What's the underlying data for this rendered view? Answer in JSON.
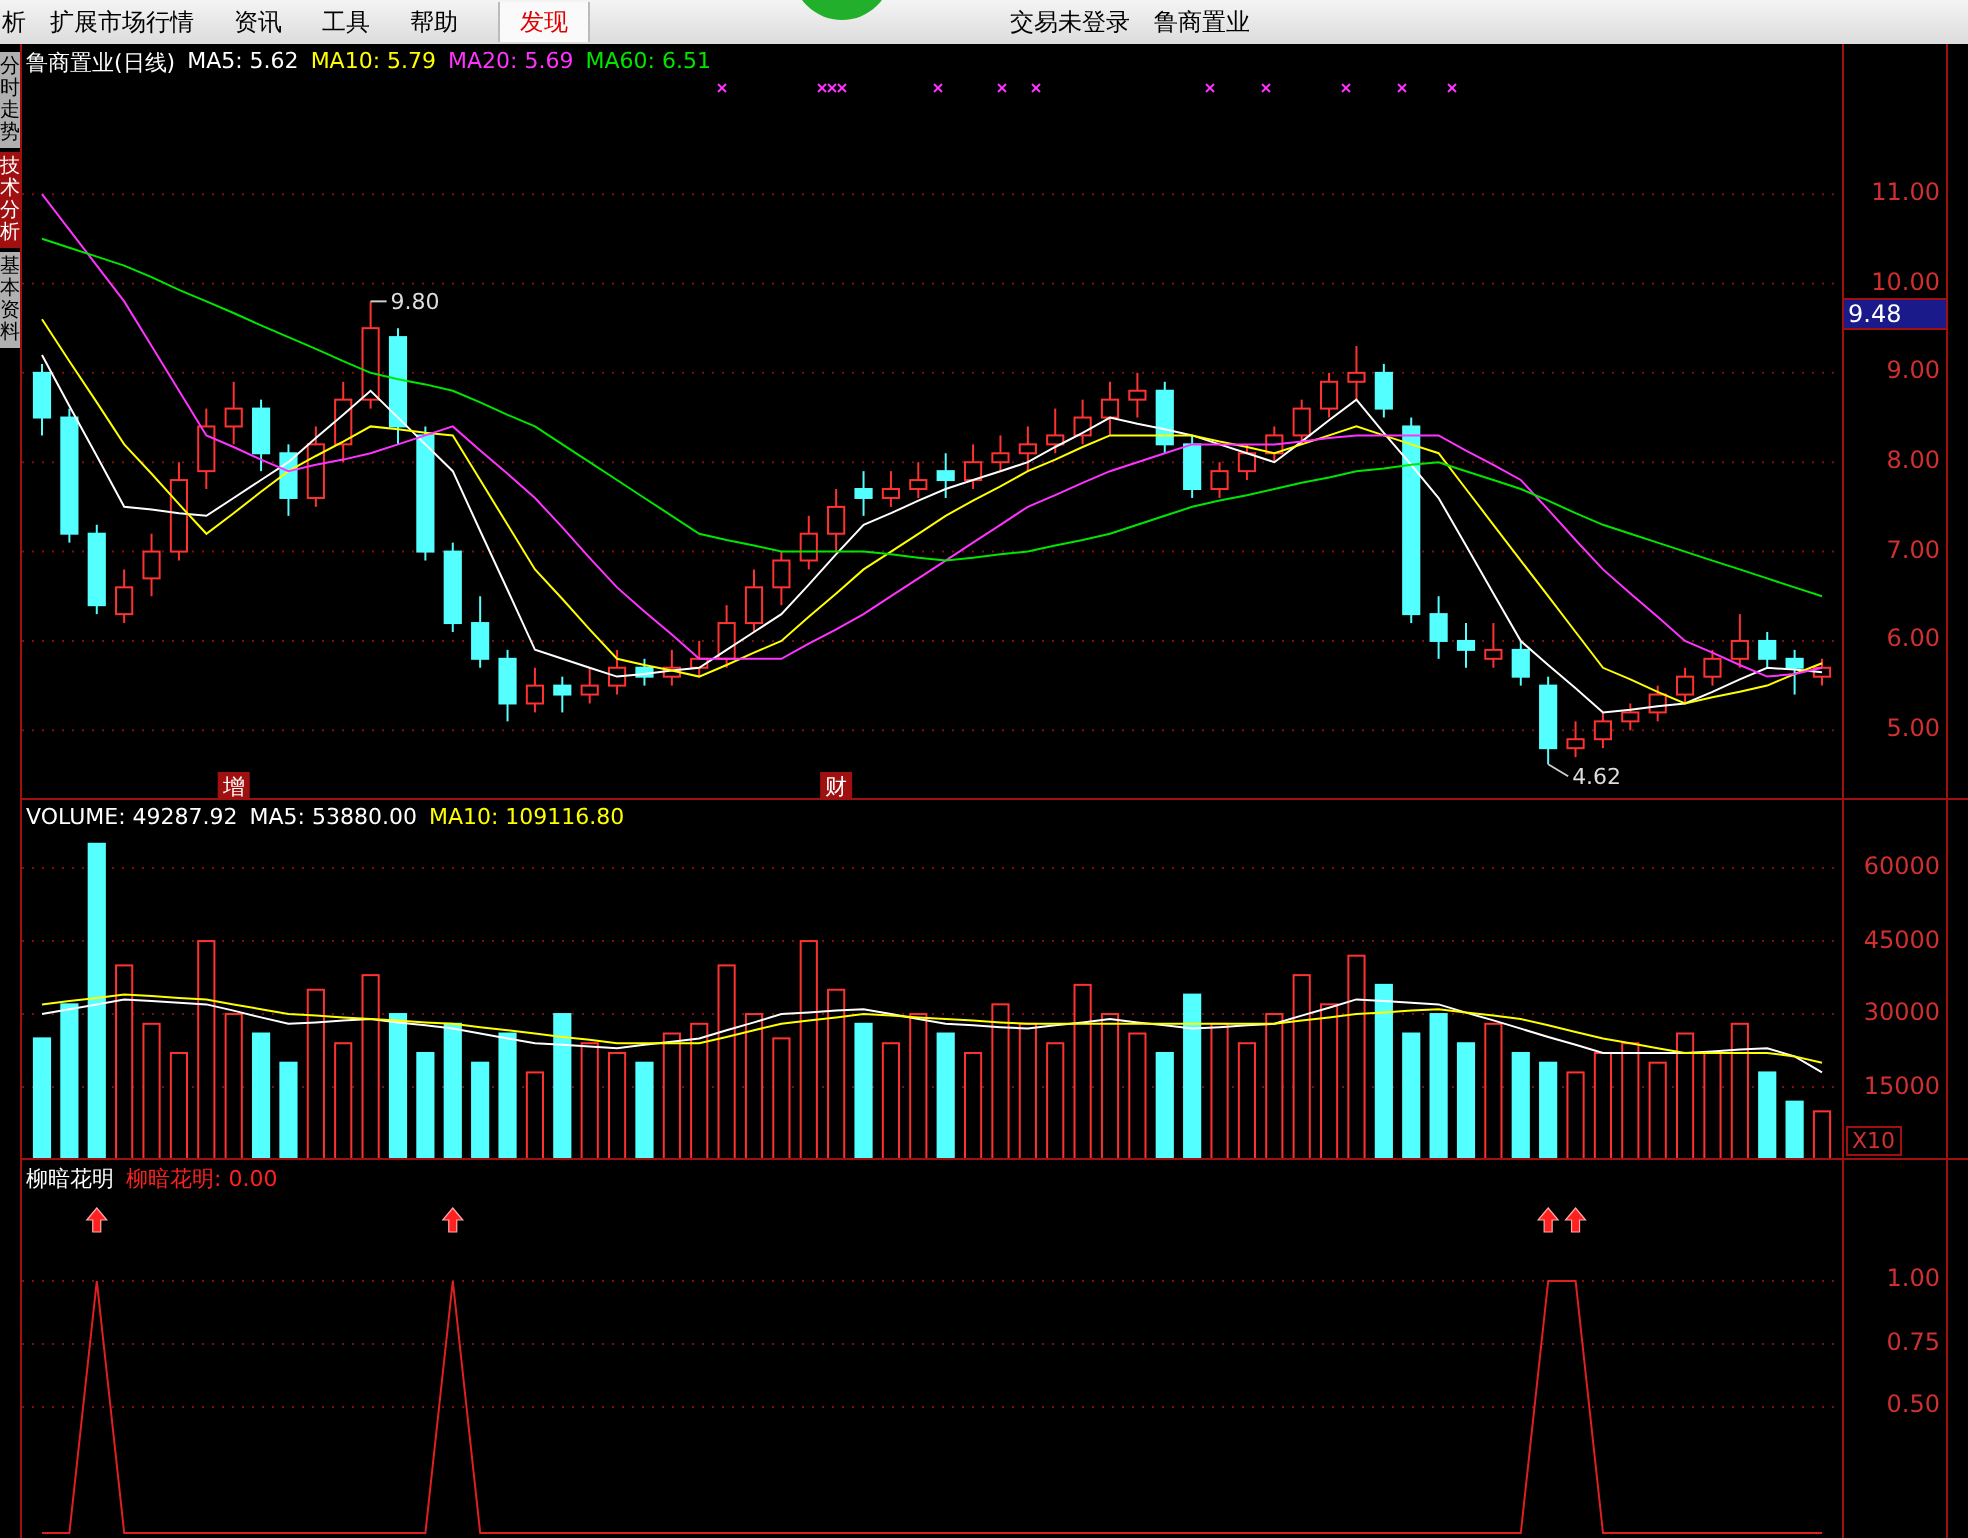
{
  "menu_bar": {
    "items": [
      {
        "label": "析",
        "selected": false
      },
      {
        "label": "扩展市场行情",
        "selected": false
      },
      {
        "label": "资讯",
        "selected": false
      },
      {
        "label": "工具",
        "selected": false
      },
      {
        "label": "帮助",
        "selected": false
      },
      {
        "label": "发现",
        "selected": true
      }
    ],
    "status": [
      "交易未登录",
      "鲁商置业"
    ]
  },
  "side_tabs": [
    {
      "label": "分时走势",
      "selected": false
    },
    {
      "label": "技术分析",
      "selected": true
    },
    {
      "label": "基本资料",
      "selected": false
    }
  ],
  "price_panel": {
    "legend": [
      {
        "text": "鲁商置业(日线)",
        "color": "#ffffff"
      },
      {
        "text": "MA5: 5.62",
        "color": "#ffffff"
      },
      {
        "text": "MA10: 5.79",
        "color": "#ffff00"
      },
      {
        "text": "MA20: 5.69",
        "color": "#ff33ff"
      },
      {
        "text": "MA60: 6.51",
        "color": "#00e600"
      }
    ],
    "current_price": "9.48",
    "high_label": "9.80",
    "low_label": "4.62",
    "event_markers": [
      "增",
      "财"
    ],
    "chart_data": {
      "type": "candlestick",
      "ylim": [
        4.22,
        12.68
      ],
      "ohlc": [
        [
          9.0,
          9.1,
          8.3,
          8.5
        ],
        [
          8.5,
          8.6,
          7.1,
          7.2
        ],
        [
          7.2,
          7.3,
          6.3,
          6.4
        ],
        [
          6.3,
          6.8,
          6.2,
          6.6
        ],
        [
          6.7,
          7.2,
          6.5,
          7.0
        ],
        [
          7.0,
          8.0,
          6.9,
          7.8
        ],
        [
          7.9,
          8.6,
          7.7,
          8.4
        ],
        [
          8.4,
          8.9,
          8.2,
          8.6
        ],
        [
          8.6,
          8.7,
          7.9,
          8.1
        ],
        [
          8.1,
          8.2,
          7.4,
          7.6
        ],
        [
          7.6,
          8.4,
          7.5,
          8.2
        ],
        [
          8.2,
          8.9,
          8.0,
          8.7
        ],
        [
          8.7,
          9.8,
          8.6,
          9.5
        ],
        [
          9.4,
          9.5,
          8.2,
          8.4
        ],
        [
          8.3,
          8.4,
          6.9,
          7.0
        ],
        [
          7.0,
          7.1,
          6.1,
          6.2
        ],
        [
          6.2,
          6.5,
          5.7,
          5.8
        ],
        [
          5.8,
          5.9,
          5.1,
          5.3
        ],
        [
          5.3,
          5.7,
          5.2,
          5.5
        ],
        [
          5.5,
          5.6,
          5.2,
          5.4
        ],
        [
          5.4,
          5.7,
          5.3,
          5.5
        ],
        [
          5.5,
          5.9,
          5.4,
          5.7
        ],
        [
          5.7,
          5.8,
          5.5,
          5.6
        ],
        [
          5.6,
          5.9,
          5.5,
          5.7
        ],
        [
          5.7,
          6.0,
          5.6,
          5.8
        ],
        [
          5.8,
          6.4,
          5.7,
          6.2
        ],
        [
          6.2,
          6.8,
          6.1,
          6.6
        ],
        [
          6.6,
          7.0,
          6.4,
          6.9
        ],
        [
          6.9,
          7.4,
          6.8,
          7.2
        ],
        [
          7.2,
          7.7,
          7.0,
          7.5
        ],
        [
          7.7,
          7.9,
          7.4,
          7.6
        ],
        [
          7.6,
          7.9,
          7.5,
          7.7
        ],
        [
          7.7,
          8.0,
          7.6,
          7.8
        ],
        [
          7.9,
          8.1,
          7.6,
          7.8
        ],
        [
          7.8,
          8.2,
          7.7,
          8.0
        ],
        [
          8.0,
          8.3,
          7.9,
          8.1
        ],
        [
          8.1,
          8.4,
          7.9,
          8.2
        ],
        [
          8.2,
          8.6,
          8.1,
          8.3
        ],
        [
          8.3,
          8.7,
          8.2,
          8.5
        ],
        [
          8.5,
          8.9,
          8.3,
          8.7
        ],
        [
          8.7,
          9.0,
          8.5,
          8.8
        ],
        [
          8.8,
          8.9,
          8.1,
          8.2
        ],
        [
          8.2,
          8.3,
          7.6,
          7.7
        ],
        [
          7.7,
          8.0,
          7.6,
          7.9
        ],
        [
          7.9,
          8.2,
          7.8,
          8.1
        ],
        [
          8.1,
          8.4,
          8.0,
          8.3
        ],
        [
          8.3,
          8.7,
          8.2,
          8.6
        ],
        [
          8.6,
          9.0,
          8.5,
          8.9
        ],
        [
          8.9,
          9.3,
          8.7,
          9.0
        ],
        [
          9.0,
          9.1,
          8.5,
          8.6
        ],
        [
          8.4,
          8.5,
          6.2,
          6.3
        ],
        [
          6.3,
          6.5,
          5.8,
          6.0
        ],
        [
          6.0,
          6.2,
          5.7,
          5.9
        ],
        [
          5.8,
          6.2,
          5.7,
          5.9
        ],
        [
          5.9,
          6.0,
          5.5,
          5.6
        ],
        [
          5.5,
          5.6,
          4.62,
          4.8
        ],
        [
          4.8,
          5.1,
          4.7,
          4.9
        ],
        [
          4.9,
          5.2,
          4.8,
          5.1
        ],
        [
          5.1,
          5.3,
          5.0,
          5.2
        ],
        [
          5.2,
          5.5,
          5.1,
          5.4
        ],
        [
          5.4,
          5.7,
          5.3,
          5.6
        ],
        [
          5.6,
          5.9,
          5.5,
          5.8
        ],
        [
          5.8,
          6.3,
          5.7,
          6.0
        ],
        [
          6.0,
          6.1,
          5.7,
          5.8
        ],
        [
          5.8,
          5.9,
          5.4,
          5.7
        ],
        [
          5.6,
          5.8,
          5.5,
          5.7
        ]
      ],
      "yticks": [
        {
          "value": 11,
          "label": "11.00"
        },
        {
          "value": 10,
          "label": "10.00"
        },
        {
          "value": 9,
          "label": "9.00"
        },
        {
          "value": 8,
          "label": "8.00"
        },
        {
          "value": 7,
          "label": "7.00"
        },
        {
          "value": 6,
          "label": "6.00"
        },
        {
          "value": 5,
          "label": "5.00"
        }
      ],
      "grid": true,
      "series": [
        {
          "type": "line",
          "color": "#ffffff",
          "values": [
            9.2,
            8.63,
            8.07,
            7.5,
            7.47,
            7.43,
            7.4,
            7.6,
            7.8,
            8.0,
            8.27,
            8.53,
            8.8,
            8.5,
            8.2,
            7.9,
            7.23,
            6.57,
            5.9,
            5.8,
            5.7,
            5.6,
            5.63,
            5.67,
            5.7,
            5.9,
            6.1,
            6.3,
            6.63,
            6.97,
            7.3,
            7.43,
            7.57,
            7.7,
            7.8,
            7.9,
            8.0,
            8.17,
            8.33,
            8.5,
            8.43,
            8.37,
            8.3,
            8.2,
            8.1,
            8.0,
            8.23,
            8.47,
            8.7,
            8.33,
            7.97,
            7.6,
            7.07,
            6.53,
            6.0,
            5.73,
            5.47,
            5.2,
            5.23,
            5.27,
            5.3,
            5.43,
            5.57,
            5.7,
            5.68,
            5.65
          ]
        },
        {
          "type": "line",
          "color": "#ffff00",
          "values": [
            9.6,
            9.13,
            8.67,
            8.2,
            7.87,
            7.53,
            7.2,
            7.43,
            7.67,
            7.9,
            8.07,
            8.23,
            8.4,
            8.37,
            8.33,
            8.3,
            7.8,
            7.3,
            6.8,
            6.47,
            6.13,
            5.8,
            5.73,
            5.67,
            5.6,
            5.73,
            5.87,
            6.0,
            6.27,
            6.53,
            6.8,
            7.0,
            7.2,
            7.4,
            7.57,
            7.73,
            7.9,
            8.03,
            8.17,
            8.3,
            8.3,
            8.3,
            8.3,
            8.23,
            8.17,
            8.1,
            8.2,
            8.3,
            8.4,
            8.3,
            8.2,
            8.1,
            7.7,
            7.3,
            6.9,
            6.5,
            6.1,
            5.7,
            5.57,
            5.43,
            5.3,
            5.37,
            5.43,
            5.5,
            5.63,
            5.75
          ]
        },
        {
          "type": "line",
          "color": "#ff33ff",
          "values": [
            11.0,
            10.6,
            10.2,
            9.8,
            9.3,
            8.8,
            8.3,
            8.17,
            8.03,
            7.9,
            7.97,
            8.03,
            8.1,
            8.2,
            8.3,
            8.4,
            8.13,
            7.87,
            7.6,
            7.27,
            6.93,
            6.6,
            6.33,
            6.07,
            5.8,
            5.8,
            5.8,
            5.8,
            5.97,
            6.13,
            6.3,
            6.5,
            6.7,
            6.9,
            7.1,
            7.3,
            7.5,
            7.63,
            7.77,
            7.9,
            8.0,
            8.1,
            8.2,
            8.2,
            8.2,
            8.2,
            8.23,
            8.27,
            8.3,
            8.3,
            8.3,
            8.3,
            8.13,
            7.97,
            7.8,
            7.47,
            7.13,
            6.8,
            6.53,
            6.27,
            6.0,
            5.87,
            5.73,
            5.6,
            5.63,
            5.7
          ]
        },
        {
          "type": "line",
          "color": "#00e600",
          "values": [
            10.5,
            10.4,
            10.3,
            10.2,
            10.07,
            9.93,
            9.8,
            9.67,
            9.53,
            9.4,
            9.27,
            9.13,
            9.0,
            8.93,
            8.87,
            8.8,
            8.67,
            8.53,
            8.4,
            8.2,
            8.0,
            7.8,
            7.6,
            7.4,
            7.2,
            7.13,
            7.07,
            7.0,
            7.0,
            7.0,
            7.0,
            6.97,
            6.93,
            6.9,
            6.93,
            6.97,
            7.0,
            7.07,
            7.13,
            7.2,
            7.3,
            7.4,
            7.5,
            7.57,
            7.63,
            7.7,
            7.77,
            7.83,
            7.9,
            7.93,
            7.97,
            8.0,
            7.9,
            7.8,
            7.7,
            7.57,
            7.43,
            7.3,
            7.2,
            7.1,
            7.0,
            6.9,
            6.8,
            6.7,
            6.6,
            6.5
          ]
        }
      ]
    }
  },
  "volume_panel": {
    "legend": [
      {
        "text": "VOLUME: 49287.92",
        "color": "#ffffff"
      },
      {
        "text": "MA5: 53880.00",
        "color": "#ffffff"
      },
      {
        "text": "MA10: 109116.80",
        "color": "#ffff00"
      }
    ],
    "scale_label": "X10",
    "chart_data": {
      "type": "bar",
      "ylim": [
        0,
        74000
      ],
      "grid": true,
      "yticks": [
        {
          "value": 60000,
          "label": "60000"
        },
        {
          "value": 45000,
          "label": "45000"
        },
        {
          "value": 30000,
          "label": "30000"
        },
        {
          "value": 15000,
          "label": "15000"
        }
      ],
      "series": [
        {
          "type": "bar",
          "colors": [
            "#54ffff",
            "#54ffff",
            "#54ffff",
            "#ff3232",
            "#ff3232",
            "#ff3232",
            "#ff3232",
            "#ff3232",
            "#54ffff",
            "#54ffff",
            "#ff3232",
            "#ff3232",
            "#ff3232",
            "#54ffff",
            "#54ffff",
            "#54ffff",
            "#54ffff",
            "#54ffff",
            "#ff3232",
            "#54ffff",
            "#ff3232",
            "#ff3232",
            "#54ffff",
            "#ff3232",
            "#ff3232",
            "#ff3232",
            "#ff3232",
            "#ff3232",
            "#ff3232",
            "#ff3232",
            "#54ffff",
            "#ff3232",
            "#ff3232",
            "#54ffff",
            "#ff3232",
            "#ff3232",
            "#ff3232",
            "#ff3232",
            "#ff3232",
            "#ff3232",
            "#ff3232",
            "#54ffff",
            "#54ffff",
            "#ff3232",
            "#ff3232",
            "#ff3232",
            "#ff3232",
            "#ff3232",
            "#ff3232",
            "#54ffff",
            "#54ffff",
            "#54ffff",
            "#54ffff",
            "#ff3232",
            "#54ffff",
            "#54ffff",
            "#ff3232",
            "#ff3232",
            "#ff3232",
            "#ff3232",
            "#ff3232",
            "#ff3232",
            "#ff3232",
            "#54ffff",
            "#54ffff",
            "#ff3232"
          ],
          "values": [
            25000,
            32000,
            65000,
            40000,
            28000,
            22000,
            45000,
            30000,
            26000,
            20000,
            35000,
            24000,
            38000,
            30000,
            22000,
            28000,
            20000,
            26000,
            18000,
            30000,
            24000,
            22000,
            20000,
            26000,
            28000,
            40000,
            30000,
            25000,
            45000,
            35000,
            28000,
            24000,
            30000,
            26000,
            22000,
            32000,
            28000,
            24000,
            36000,
            30000,
            26000,
            22000,
            34000,
            28000,
            24000,
            30000,
            38000,
            32000,
            42000,
            36000,
            26000,
            30000,
            24000,
            28000,
            22000,
            20000,
            18000,
            22000,
            24000,
            20000,
            26000,
            22000,
            28000,
            18000,
            12000,
            10000
          ]
        },
        {
          "type": "line",
          "color": "#ffffff",
          "values": [
            30000,
            31000,
            32000,
            33000,
            32700,
            32300,
            32000,
            30700,
            29300,
            28000,
            28300,
            28700,
            29000,
            28300,
            27700,
            27000,
            26000,
            25000,
            24000,
            23700,
            23300,
            23000,
            23700,
            24300,
            25000,
            26700,
            28300,
            30000,
            30300,
            30700,
            31000,
            30000,
            29000,
            28000,
            27700,
            27300,
            27000,
            27700,
            28300,
            29000,
            28300,
            27700,
            27000,
            27300,
            27700,
            28000,
            29700,
            31300,
            33000,
            32700,
            32300,
            32000,
            30300,
            28700,
            27000,
            25300,
            23700,
            22000,
            22000,
            22000,
            22000,
            22300,
            22700,
            23000,
            21300,
            18000
          ]
        },
        {
          "type": "line",
          "color": "#ffff00",
          "values": [
            32000,
            32700,
            33300,
            34000,
            33700,
            33300,
            33000,
            32000,
            31000,
            30000,
            29700,
            29300,
            29000,
            28700,
            28300,
            28000,
            27300,
            26700,
            26000,
            25300,
            24700,
            24000,
            24000,
            24000,
            24000,
            25300,
            26700,
            28000,
            28700,
            29300,
            30000,
            29700,
            29300,
            29000,
            28700,
            28300,
            28000,
            28000,
            28000,
            28000,
            28000,
            28000,
            28000,
            28000,
            28000,
            28000,
            28700,
            29300,
            30000,
            30300,
            30700,
            31000,
            30300,
            29700,
            29000,
            27700,
            26300,
            25000,
            24000,
            23000,
            22000,
            22000,
            22000,
            22000,
            21300,
            20000
          ]
        }
      ]
    }
  },
  "indicator_panel": {
    "legend": [
      {
        "text": "柳暗花明",
        "color": "#ffffff"
      },
      {
        "text": "柳暗花明: 0.00",
        "color": "#ff2020"
      }
    ],
    "chart_data": {
      "type": "line",
      "ylim": [
        -0.02,
        1.48
      ],
      "grid": true,
      "yticks": [
        {
          "value": 1,
          "label": "1.00"
        },
        {
          "value": 0.75,
          "label": "0.75"
        },
        {
          "value": 0.5,
          "label": "0.50"
        }
      ],
      "series": [
        {
          "color": "#e02020",
          "values": [
            0,
            0,
            1,
            0,
            0,
            0,
            0,
            0,
            0,
            0,
            0,
            0,
            0,
            0,
            0,
            1,
            0,
            0,
            0,
            0,
            0,
            0,
            0,
            0,
            0,
            0,
            0,
            0,
            0,
            0,
            0,
            0,
            0,
            0,
            0,
            0,
            0,
            0,
            0,
            0,
            0,
            0,
            0,
            0,
            0,
            0,
            0,
            0,
            0,
            0,
            0,
            0,
            0,
            0,
            0,
            1,
            1,
            0,
            0,
            0,
            0,
            0,
            0,
            0,
            0,
            0
          ]
        }
      ]
    }
  }
}
